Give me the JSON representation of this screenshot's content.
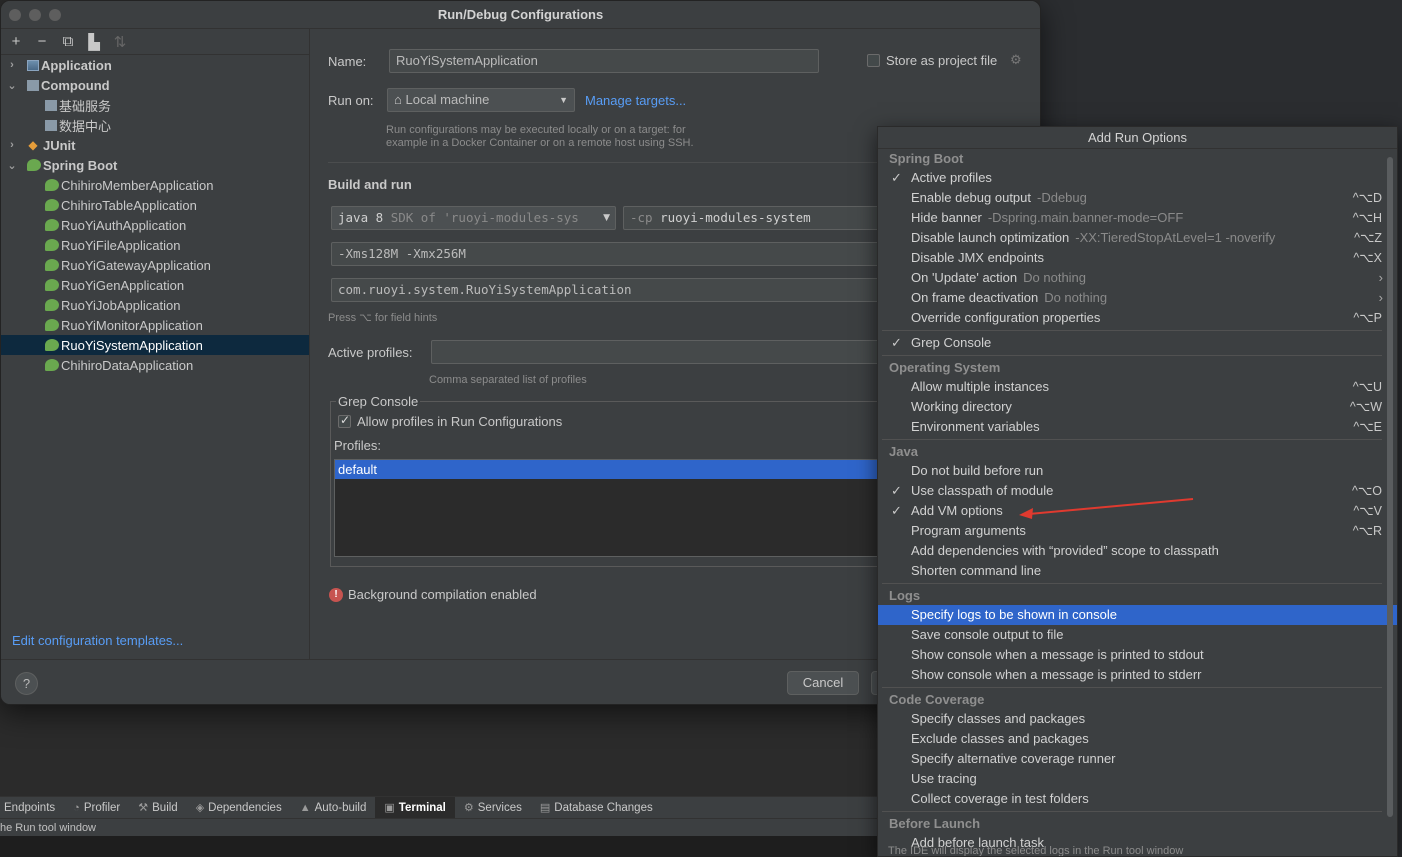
{
  "dialog": {
    "title": "Run/Debug Configurations",
    "toolbar_icons": [
      "add-icon",
      "remove-icon",
      "copy-icon",
      "folder-icon",
      "sort-icon"
    ],
    "tree": [
      {
        "label": "Application",
        "level": 0,
        "expanded": false,
        "bold": true,
        "icon": "application-icon"
      },
      {
        "label": "Compound",
        "level": 0,
        "expanded": true,
        "bold": true,
        "icon": "compound-icon"
      },
      {
        "label": "基础服务",
        "level": 1,
        "icon": "compound-icon"
      },
      {
        "label": "数据中心",
        "level": 1,
        "icon": "compound-icon"
      },
      {
        "label": "JUnit",
        "level": 0,
        "expanded": false,
        "bold": true,
        "icon": "junit-icon"
      },
      {
        "label": "Spring Boot",
        "level": 0,
        "expanded": true,
        "bold": true,
        "icon": "spring-boot-icon"
      },
      {
        "label": "ChihiroMemberApplication",
        "level": 1,
        "icon": "spring-boot-icon"
      },
      {
        "label": "ChihiroTableApplication",
        "level": 1,
        "icon": "spring-boot-icon"
      },
      {
        "label": "RuoYiAuthApplication",
        "level": 1,
        "icon": "spring-boot-icon"
      },
      {
        "label": "RuoYiFileApplication",
        "level": 1,
        "icon": "spring-boot-icon"
      },
      {
        "label": "RuoYiGatewayApplication",
        "level": 1,
        "icon": "spring-boot-icon"
      },
      {
        "label": "RuoYiGenApplication",
        "level": 1,
        "icon": "spring-boot-icon"
      },
      {
        "label": "RuoYiJobApplication",
        "level": 1,
        "icon": "spring-boot-icon"
      },
      {
        "label": "RuoYiMonitorApplication",
        "level": 1,
        "icon": "spring-boot-icon"
      },
      {
        "label": "RuoYiSystemApplication",
        "level": 1,
        "icon": "spring-boot-icon",
        "selected": true
      },
      {
        "label": "ChihiroDataApplication",
        "level": 1,
        "icon": "spring-boot-icon"
      }
    ],
    "edit_templates_link": "Edit configuration templates...",
    "form": {
      "name_label": "Name:",
      "name_value": "RuoYiSystemApplication",
      "store_label": "Store as project file",
      "run_on_label": "Run on:",
      "run_on_value": "Local machine",
      "manage_targets": "Manage targets...",
      "run_on_hint_1": "Run configurations may be executed locally or on a target: for",
      "run_on_hint_2": "example in a Docker Container or on a remote host using SSH.",
      "build_run_title": "Build and run",
      "jdk_value": "java 8",
      "jdk_suffix": "SDK of 'ruoyi-modules-sys",
      "cp_prefix": "-cp",
      "cp_value": "ruoyi-modules-system",
      "vm_options": "-Xms128M -Xmx256M",
      "main_class": "com.ruoyi.system.RuoYiSystemApplication",
      "field_hints": "Press ⌥ for field hints",
      "active_profiles_label": "Active profiles:",
      "active_profiles_value": "",
      "active_profiles_hint": "Comma separated list of profiles",
      "grep_console_title": "Grep Console",
      "allow_profiles_label": "Allow profiles in Run Configurations",
      "allow_profiles_checked": true,
      "profiles_label": "Profiles:",
      "profiles": [
        "default"
      ],
      "bg_compilation": "Background compilation enabled"
    },
    "buttons": {
      "help": "?",
      "cancel": "Cancel"
    }
  },
  "popup": {
    "title": "Add Run Options",
    "groups": [
      {
        "name": "Spring Boot",
        "items": [
          {
            "label": "Active profiles",
            "checked": true
          },
          {
            "label": "Enable debug output",
            "extra": "-Ddebug",
            "shortcut": "^⌥D"
          },
          {
            "label": "Hide banner",
            "extra": "-Dspring.main.banner-mode=OFF",
            "shortcut": "^⌥H"
          },
          {
            "label": "Disable launch optimization",
            "extra": "-XX:TieredStopAtLevel=1 -noverify",
            "shortcut": "^⌥Z"
          },
          {
            "label": "Disable JMX endpoints",
            "shortcut": "^⌥X"
          },
          {
            "label": "On 'Update' action",
            "extra": "Do nothing",
            "submenu": true
          },
          {
            "label": "On frame deactivation",
            "extra": "Do nothing",
            "submenu": true
          },
          {
            "label": "Override configuration properties",
            "shortcut": "^⌥P"
          }
        ]
      },
      {
        "name": "",
        "items": [
          {
            "label": "Grep Console",
            "checked": true
          }
        ]
      },
      {
        "name": "Operating System",
        "items": [
          {
            "label": "Allow multiple instances",
            "shortcut": "^⌥U"
          },
          {
            "label": "Working directory",
            "shortcut": "^⌥W"
          },
          {
            "label": "Environment variables",
            "shortcut": "^⌥E"
          }
        ]
      },
      {
        "name": "Java",
        "items": [
          {
            "label": "Do not build before run"
          },
          {
            "label": "Use classpath of module",
            "checked": true,
            "shortcut": "^⌥O"
          },
          {
            "label": "Add VM options",
            "checked": true,
            "shortcut": "^⌥V"
          },
          {
            "label": "Program arguments",
            "shortcut": "^⌥R"
          },
          {
            "label": "Add dependencies with “provided” scope to classpath"
          },
          {
            "label": "Shorten command line"
          }
        ]
      },
      {
        "name": "Logs",
        "items": [
          {
            "label": "Specify logs to be shown in console",
            "highlighted": true
          },
          {
            "label": "Save console output to file"
          },
          {
            "label": "Show console when a message is printed to stdout"
          },
          {
            "label": "Show console when a message is printed to stderr"
          }
        ]
      },
      {
        "name": "Code Coverage",
        "items": [
          {
            "label": "Specify classes and packages"
          },
          {
            "label": "Exclude classes and packages"
          },
          {
            "label": "Specify alternative coverage runner"
          },
          {
            "label": "Use tracing"
          },
          {
            "label": "Collect coverage in test folders"
          }
        ]
      },
      {
        "name": "Before Launch",
        "items": [
          {
            "label": "Add before launch task"
          }
        ]
      }
    ],
    "footer": "The IDE will display the selected logs in the Run tool window"
  },
  "ide": {
    "tool_tabs": [
      {
        "label": "Endpoints",
        "icon": "endpoints-icon"
      },
      {
        "label": "Profiler",
        "icon": "profiler-icon"
      },
      {
        "label": "Build",
        "icon": "hammer-icon"
      },
      {
        "label": "Dependencies",
        "icon": "dependencies-icon"
      },
      {
        "label": "Auto-build",
        "icon": "warning-icon"
      },
      {
        "label": "Terminal",
        "icon": "terminal-icon",
        "active": true
      },
      {
        "label": "Services",
        "icon": "services-icon"
      },
      {
        "label": "Database Changes",
        "icon": "database-icon"
      }
    ],
    "status_text": "he Run tool window"
  },
  "colors": {
    "accent": "#2f65ca",
    "link": "#589df6",
    "selection": "#0d293e",
    "annotation_arrow": "#e03a2f"
  }
}
